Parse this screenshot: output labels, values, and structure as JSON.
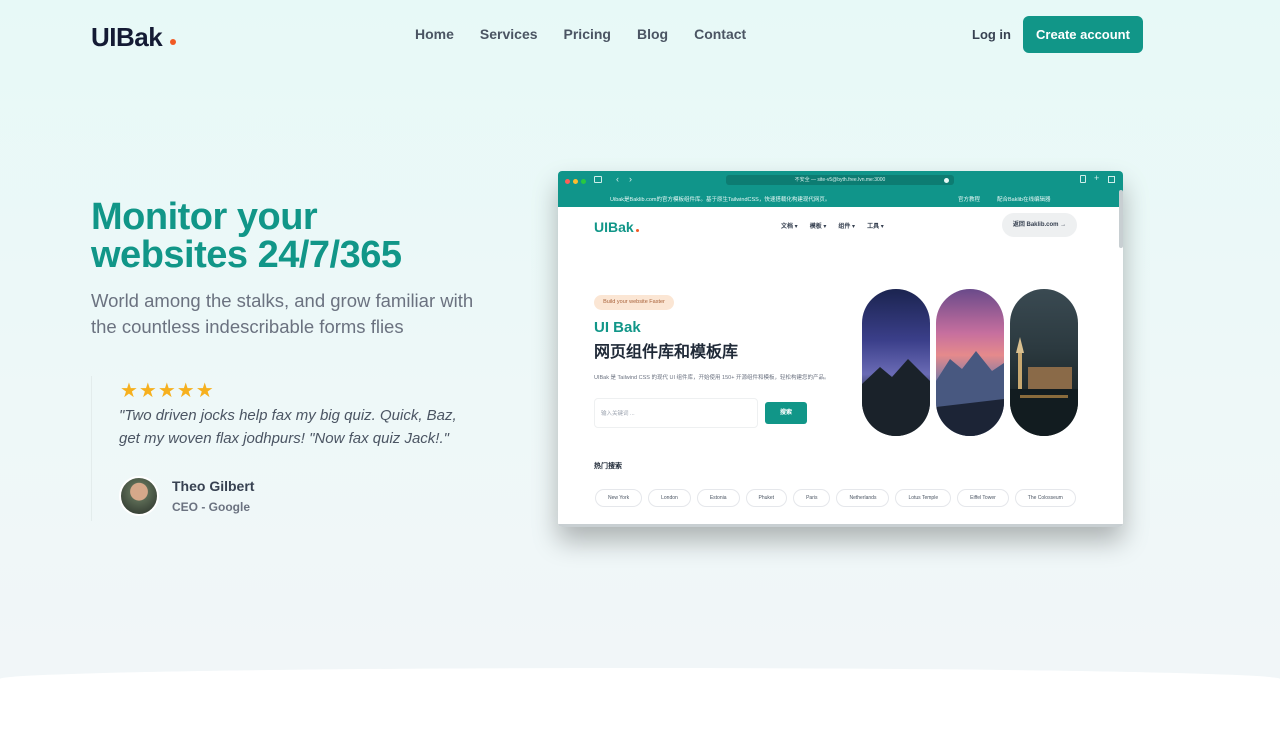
{
  "nav": {
    "logo": "UIBak",
    "links": [
      "Home",
      "Services",
      "Pricing",
      "Blog",
      "Contact"
    ],
    "login": "Log in",
    "create_account": "Create account"
  },
  "hero": {
    "title_line1": "Monitor your",
    "title_line2": "websites 24/7/365",
    "subtitle": "World among the stalks, and grow familiar with the countless indescribable forms flies"
  },
  "review": {
    "stars": "★★★★★",
    "rating": 5,
    "quote": "\"Two driven jocks help fax my big quiz. Quick, Baz, get my woven flax jodhpurs! \"Now fax quiz Jack!.\"",
    "author_name": "Theo Gilbert",
    "author_role": "CEO - Google"
  },
  "screenshot": {
    "url": "不安全 — site-v5@byth.free.lvn.me:3000",
    "notice_left": "Uibak是Baklib.com的官方模板组件库。基于原生TailwindCSS，快速搭载化构建现代网页。",
    "notice_right1": "官方教程",
    "notice_right2": "配合Baklib在线编辑器",
    "logo": "UIBak",
    "menu": [
      "文档 ▾",
      "模板 ▾",
      "组件 ▾",
      "工具 ▾"
    ],
    "return_btn": "返回 Baklib.com →",
    "tag": "Build your website Faster",
    "heading1": "UI Bak",
    "heading2": "网页组件库和模板库",
    "description": "UIBak 是 Tailwind CSS 的现代 UI 组件库，开始使用 150+ 开源组件和模板，轻松构建您的产品。",
    "search_placeholder": "输入关键词 ...",
    "search_button": "搜索",
    "hot_title": "热门搜索",
    "chips": [
      "New York",
      "London",
      "Estonia",
      "Phuket",
      "Paris",
      "Netherlands",
      "Lotus Temple",
      "Eiffel Tower",
      "The Colosseum"
    ]
  },
  "colors": {
    "brand": "#119688",
    "accent_dot": "#f15a24",
    "star": "#f6b01e"
  }
}
